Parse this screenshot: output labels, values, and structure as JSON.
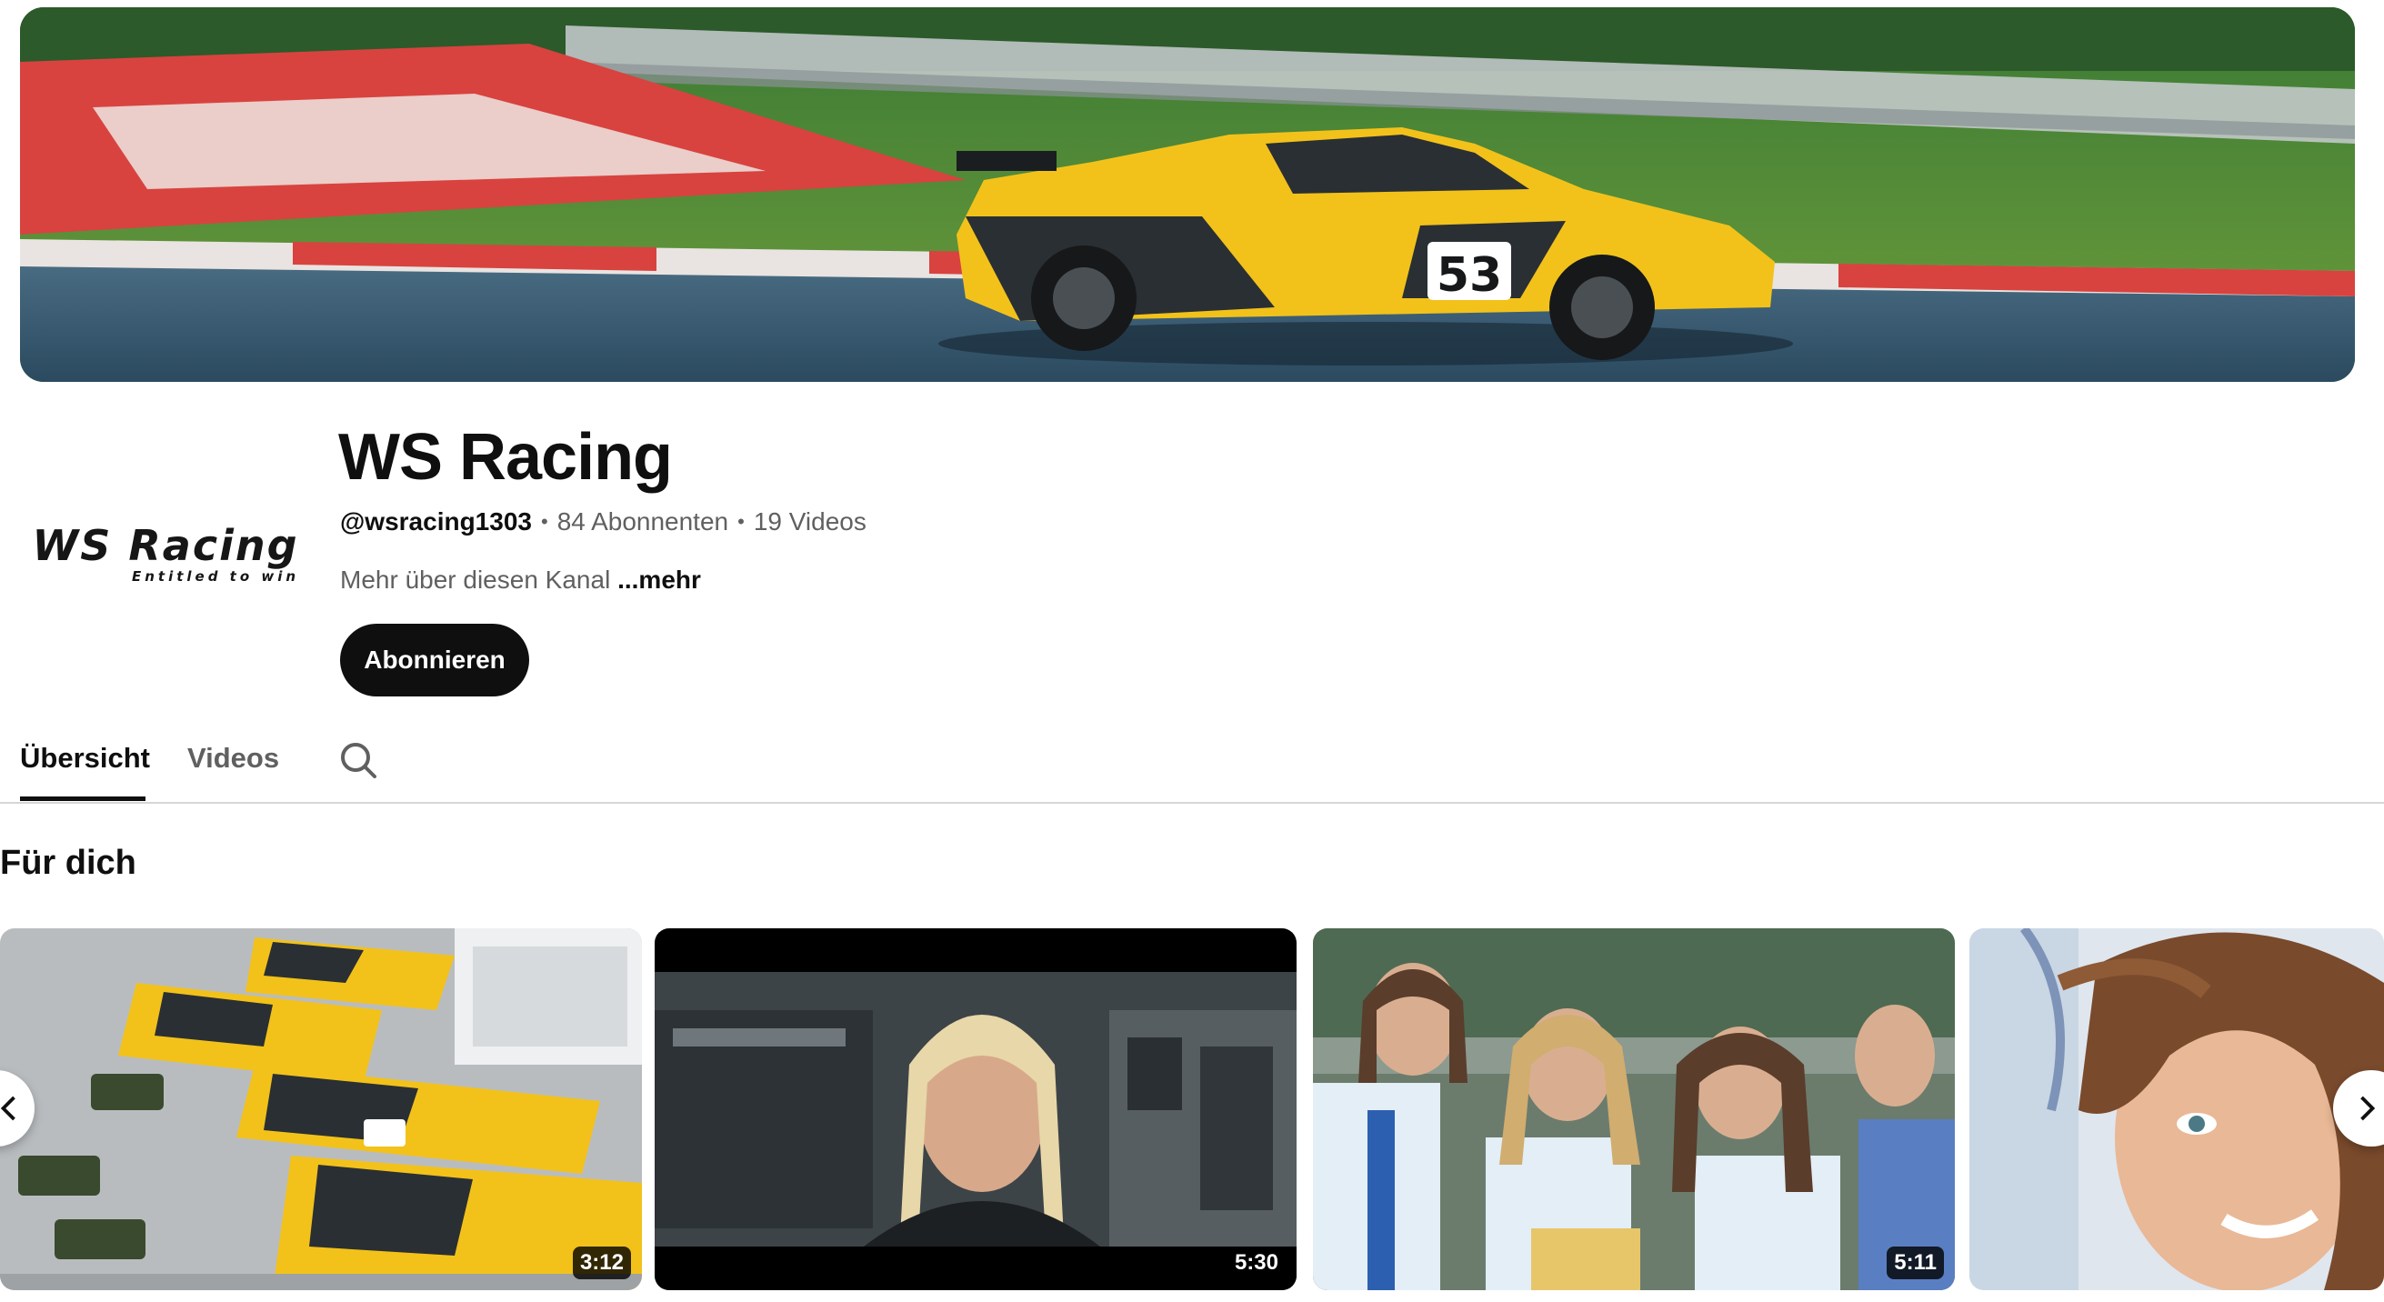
{
  "channel": {
    "name": "WS Racing",
    "handle": "@wsracing1303",
    "subscribers": "84 Abonnenten",
    "videos": "19 Videos",
    "separator": "•",
    "about": "Mehr über diesen Kanal",
    "more_label": "...mehr",
    "subscribe_label": "Abonnieren",
    "logo": {
      "main": "WS Racing",
      "tagline": "Entitled to win"
    },
    "banner": {
      "car_number": "53"
    }
  },
  "tabs": [
    {
      "label": "Übersicht",
      "active": true
    },
    {
      "label": "Videos",
      "active": false
    }
  ],
  "search_icon": "search-icon",
  "shelf": {
    "title": "Für dich",
    "videos": [
      {
        "duration": "3:12",
        "scene": "race cars and karts in paddock"
      },
      {
        "duration": "5:30",
        "scene": "woman in team shirt in garage"
      },
      {
        "duration": "5:11",
        "scene": "grid girls at race track"
      },
      {
        "duration": "",
        "scene": "woman with flowing hair"
      }
    ],
    "prev_icon": "chevron-left-icon",
    "next_icon": "chevron-right-icon"
  },
  "colors": {
    "car_yellow": "#f2c21b",
    "car_dark": "#2a2f33",
    "button_bg": "#0f0f0f",
    "secondary_text": "#606060"
  }
}
